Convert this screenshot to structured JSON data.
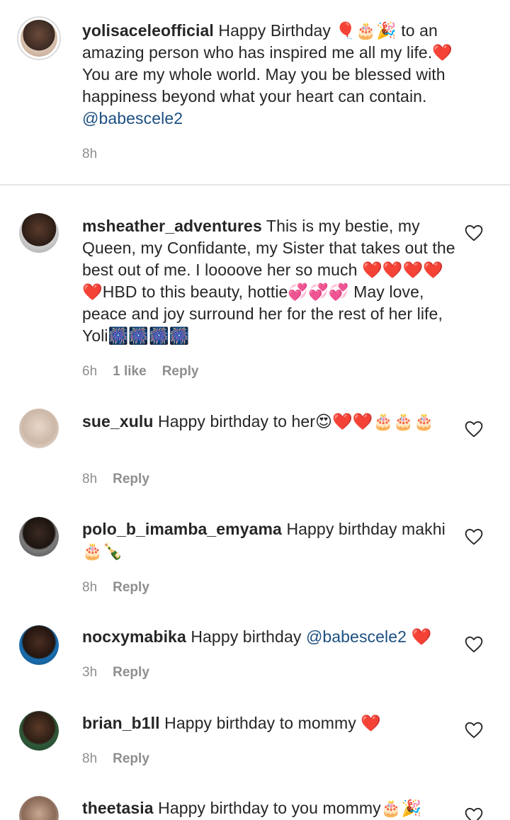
{
  "caption": {
    "username": "yolisaceleofficial",
    "text_before": " Happy Birthday 🎈🎂🎉 to an amazing person who has inspired me all my life.❤️ You are my whole world. May you be blessed with happiness beyond what your heart can contain.",
    "mention": "@babescele2",
    "time": "8h"
  },
  "comments": [
    {
      "username": "msheather_adventures",
      "text": " This is my bestie, my Queen, my Confidante, my Sister that takes out the best out of me. I loooove her so much ❤️❤️❤️❤️❤️HBD to this beauty, hottie💞💞💞 May love, peace and joy surround her for the rest of her life, Yoli🎆🎆🎆🎆",
      "time": "6h",
      "likes": "1 like",
      "reply": "Reply"
    },
    {
      "username": "sue_xulu",
      "text": " Happy birthday to her😍❤️❤️🎂🎂🎂",
      "time": "8h",
      "reply": "Reply"
    },
    {
      "username": "polo_b_imamba_emyama",
      "text": " Happy birthday makhi 🎂🍾",
      "time": "8h",
      "reply": "Reply"
    },
    {
      "username": "nocxymabika",
      "text": " Happy birthday ",
      "mention": "@babescele2",
      "text_after": " ❤️",
      "time": "3h",
      "reply": "Reply"
    },
    {
      "username": "brian_b1ll",
      "text": " Happy birthday to mommy ❤️",
      "time": "8h",
      "reply": "Reply"
    },
    {
      "username": "theetasia",
      "text": " Happy birthday to you mommy🎂🎉"
    }
  ],
  "icons": {
    "like": "heart-outline-icon"
  },
  "colors": {
    "text": "#262626",
    "secondary": "#8e8e8e",
    "mention": "#1c4f80",
    "divider": "#e6e6e6"
  }
}
